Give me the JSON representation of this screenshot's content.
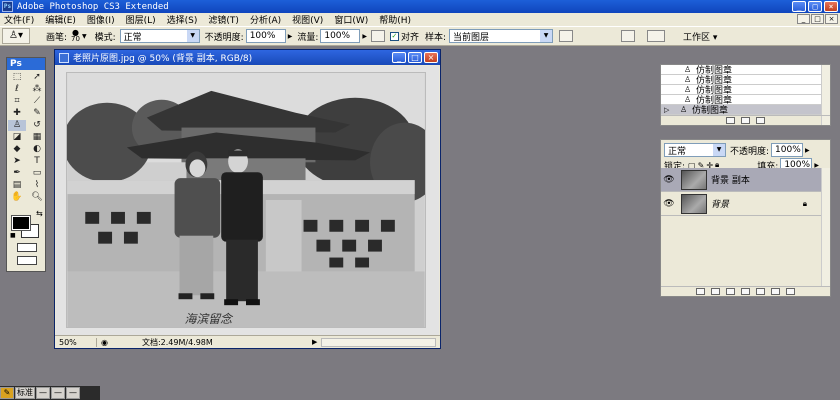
{
  "app": {
    "title": "Adobe Photoshop CS3 Extended",
    "ps_badge": "Ps"
  },
  "menu": [
    "文件(F)",
    "编辑(E)",
    "图像(I)",
    "图层(L)",
    "选择(S)",
    "滤镜(T)",
    "分析(A)",
    "视图(V)",
    "窗口(W)",
    "帮助(H)"
  ],
  "options": {
    "brush_label": "画笔:",
    "brush_size": "70",
    "mode_label": "模式:",
    "mode_value": "正常",
    "opacity_label": "不透明度:",
    "opacity_value": "100%",
    "flow_label": "流量:",
    "flow_value": "100%",
    "aligned_label": "对齐",
    "sample_label": "样本:",
    "sample_value": "当前图层",
    "workspace_label": "工作区"
  },
  "document": {
    "title": "老照片原图.jpg @ 50% (背景 副本, RGB/8)",
    "zoom": "50%",
    "doc_info": "文档:2.49M/4.98M",
    "photo_caption": "海滨留念"
  },
  "history": {
    "items": [
      "仿制图章",
      "仿制图章",
      "仿制图章",
      "仿制图章",
      "仿制图章"
    ]
  },
  "layers": {
    "blend_mode": "正常",
    "opacity_label": "不透明度:",
    "opacity_value": "100%",
    "lock_label": "锁定:",
    "fill_label": "填充:",
    "fill_value": "100%",
    "items": [
      {
        "name": "背景 副本"
      },
      {
        "name": "背景"
      }
    ]
  },
  "taskbar": {
    "label": "标准"
  }
}
